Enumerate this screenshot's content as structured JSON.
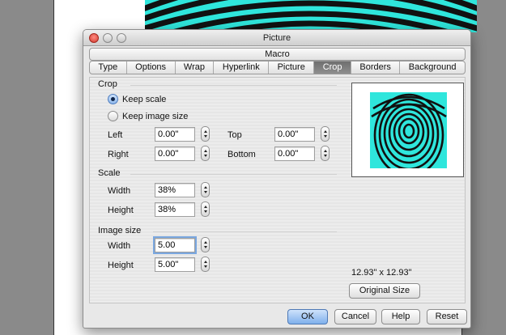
{
  "window": {
    "title": "Picture"
  },
  "macro_tab": "Macro",
  "tabs": [
    "Type",
    "Options",
    "Wrap",
    "Hyperlink",
    "Picture",
    "Crop",
    "Borders",
    "Background"
  ],
  "active_tab": "Crop",
  "crop": {
    "section_label": "Crop",
    "keep_scale_label": "Keep scale",
    "keep_image_size_label": "Keep image size",
    "selected_option": "Keep scale",
    "left_label": "Left",
    "left_value": "0.00\"",
    "right_label": "Right",
    "right_value": "0.00\"",
    "top_label": "Top",
    "top_value": "0.00\"",
    "bottom_label": "Bottom",
    "bottom_value": "0.00\""
  },
  "scale": {
    "section_label": "Scale",
    "width_label": "Width",
    "width_value": "38%",
    "height_label": "Height",
    "height_value": "38%"
  },
  "image_size": {
    "section_label": "Image size",
    "width_label": "Width",
    "width_value": "5.00",
    "height_label": "Height",
    "height_value": "5.00\""
  },
  "original_size_text": "12.93\" x 12.93\"",
  "buttons": {
    "original_size": "Original Size",
    "ok": "OK",
    "cancel": "Cancel",
    "help": "Help",
    "reset": "Reset"
  },
  "icons": [
    "close-icon",
    "minimize-icon",
    "zoom-icon",
    "stepper-up-icon",
    "stepper-down-icon"
  ],
  "colors": {
    "image_cyan": "#2fe6dc",
    "accent_blue": "#7fb0ec",
    "active_tab": "#7a7a7a"
  }
}
